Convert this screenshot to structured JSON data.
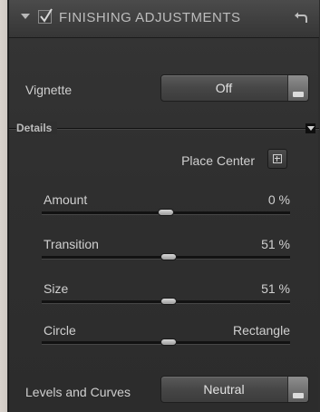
{
  "header": {
    "title": "FINISHING ADJUSTMENTS",
    "enabled": true,
    "collapse_icon": "disclosure-triangle-down",
    "reset_icon": "reset-arrow-icon"
  },
  "vignette": {
    "label": "Vignette",
    "value": "Off"
  },
  "details": {
    "label": "Details",
    "place_center_label": "Place Center",
    "sliders": [
      {
        "label": "Amount",
        "value": "0 %",
        "position": 0.5
      },
      {
        "label": "Transition",
        "value": "51 %",
        "position": 0.51
      },
      {
        "label": "Size",
        "value": "51 %",
        "position": 0.51
      },
      {
        "label": "Circle",
        "value": "Rectangle",
        "position": 0.51
      }
    ]
  },
  "levels": {
    "label": "Levels and Curves",
    "value": "Neutral"
  },
  "colors": {
    "panel_bg": "#2f2f2f",
    "header_bg": "#424242",
    "text": "#d0d0d0"
  }
}
